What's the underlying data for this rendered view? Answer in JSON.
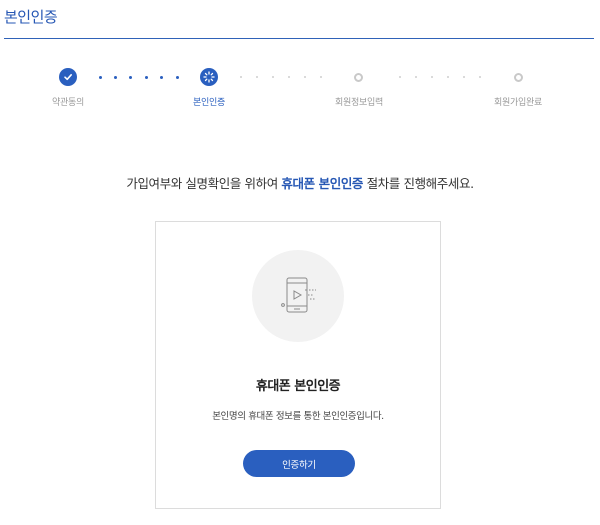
{
  "header": {
    "title": "본인인증"
  },
  "steps": [
    {
      "label": "약관동의",
      "state": "done",
      "icon": "check-icon"
    },
    {
      "label": "본인인증",
      "state": "current",
      "icon": "spinner-icon"
    },
    {
      "label": "회원정보입력",
      "state": "pending",
      "icon": "circle-icon"
    },
    {
      "label": "회원가입완료",
      "state": "pending",
      "icon": "circle-icon"
    }
  ],
  "instruction": {
    "before": "가입여부와 실명확인을 위하여 ",
    "highlight": "휴대폰 본인인증",
    "after": " 절차를 진행해주세요."
  },
  "card": {
    "icon": "phone-verification-icon",
    "title": "휴대폰 본인인증",
    "description": "본인명의 휴대폰 정보를 통한 본인인증입니다.",
    "button_label": "인증하기"
  },
  "colors": {
    "accent": "#2a5fbf",
    "title": "#2657b4",
    "inactive": "#c9c9c9"
  }
}
